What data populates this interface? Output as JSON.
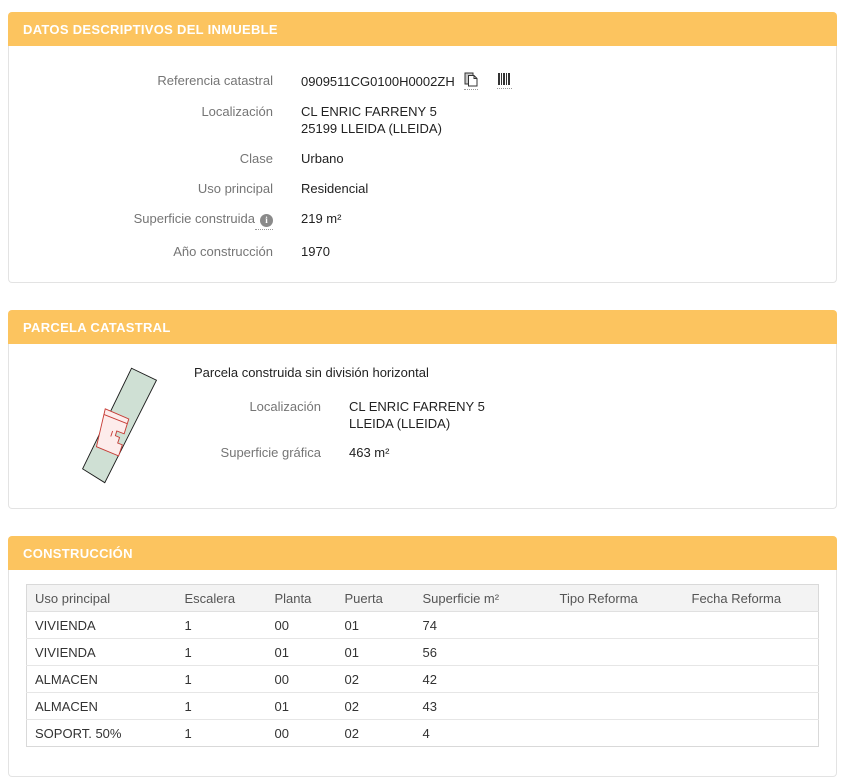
{
  "theme": {
    "accent_orange": "#fcc45f",
    "header_text": "#ffffff",
    "label_gray": "#757575",
    "value_dark": "#222222",
    "panel_border": "#e3e3e3",
    "table_header_bg": "#f3f3f3",
    "parcel_fill_green": "#cfe0d4",
    "parcel_fill_pink": "#fdeceb",
    "parcel_stroke_red": "#c63b35"
  },
  "descriptive": {
    "title": "DATOS DESCRIPTIVOS DEL INMUEBLE",
    "fields": {
      "referencia": {
        "label": "Referencia catastral",
        "value": "0909511CG0100H0002ZH"
      },
      "localizacion": {
        "label": "Localización",
        "line1": "CL ENRIC FARRENY 5",
        "line2": "25199 LLEIDA (LLEIDA)"
      },
      "clase": {
        "label": "Clase",
        "value": "Urbano"
      },
      "uso": {
        "label": "Uso principal",
        "value": "Residencial"
      },
      "superficie": {
        "label": "Superficie construida",
        "value": "219 m²"
      },
      "anio": {
        "label": "Año construcción",
        "value": "1970"
      }
    },
    "icons": {
      "copy": "copy-icon",
      "barcode": "barcode-icon",
      "info": "info-icon",
      "info_glyph": "i"
    }
  },
  "parcela": {
    "title": "PARCELA CATASTRAL",
    "subtitle": "Parcela construida sin división horizontal",
    "fields": {
      "localizacion": {
        "label": "Localización",
        "line1": "CL ENRIC FARRENY 5",
        "line2": "LLEIDA (LLEIDA)"
      },
      "superficie": {
        "label": "Superficie gráfica",
        "value": "463 m²"
      }
    }
  },
  "construccion": {
    "title": "CONSTRUCCIÓN",
    "headers": [
      "Uso principal",
      "Escalera",
      "Planta",
      "Puerta",
      "Superficie m²",
      "Tipo Reforma",
      "Fecha Reforma"
    ],
    "rows": [
      {
        "uso": "VIVIENDA",
        "escalera": "1",
        "planta": "00",
        "puerta": "01",
        "superficie": "74",
        "tipo_reforma": "",
        "fecha_reforma": ""
      },
      {
        "uso": "VIVIENDA",
        "escalera": "1",
        "planta": "01",
        "puerta": "01",
        "superficie": "56",
        "tipo_reforma": "",
        "fecha_reforma": ""
      },
      {
        "uso": "ALMACEN",
        "escalera": "1",
        "planta": "00",
        "puerta": "02",
        "superficie": "42",
        "tipo_reforma": "",
        "fecha_reforma": ""
      },
      {
        "uso": "ALMACEN",
        "escalera": "1",
        "planta": "01",
        "puerta": "02",
        "superficie": "43",
        "tipo_reforma": "",
        "fecha_reforma": ""
      },
      {
        "uso": "SOPORT. 50%",
        "escalera": "1",
        "planta": "00",
        "puerta": "02",
        "superficie": "4",
        "tipo_reforma": "",
        "fecha_reforma": ""
      }
    ]
  }
}
